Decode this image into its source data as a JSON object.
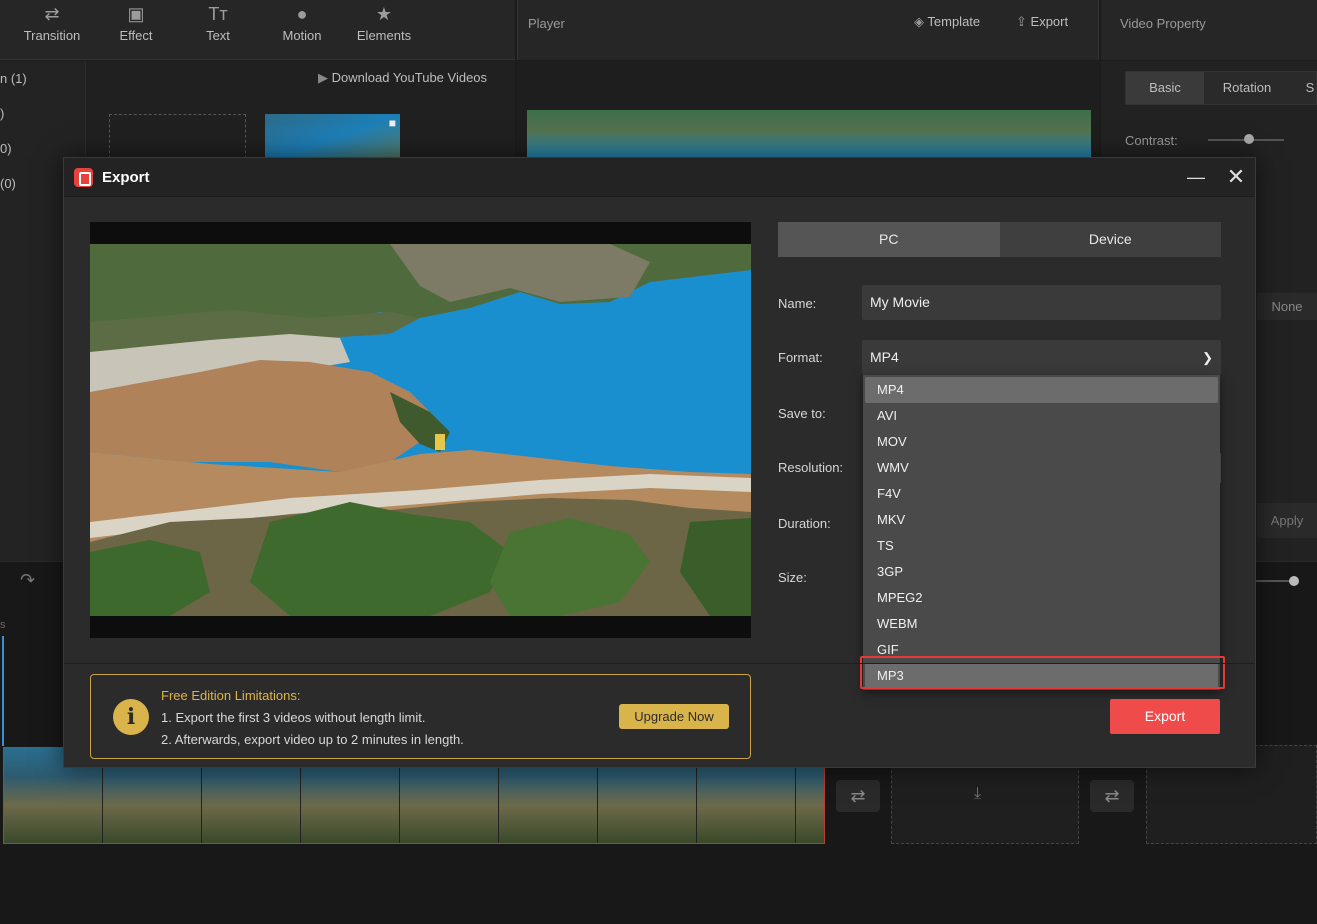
{
  "toolbar": {
    "items": [
      {
        "label": "Transition",
        "icon": "transition-icon"
      },
      {
        "label": "Effect",
        "icon": "effect-icon"
      },
      {
        "label": "Text",
        "icon": "text-icon"
      },
      {
        "label": "Motion",
        "icon": "motion-icon"
      },
      {
        "label": "Elements",
        "icon": "elements-icon"
      }
    ]
  },
  "media": {
    "sidebar": [
      "n (1)",
      ")",
      "0)",
      "(0)"
    ],
    "download_label": "Download YouTube Videos"
  },
  "player": {
    "title": "Player",
    "template_label": "Template",
    "export_label": "Export"
  },
  "property": {
    "title": "Video Property",
    "tabs": [
      "Basic",
      "Rotation",
      "S"
    ],
    "contrast_label": "Contrast:",
    "none_label": "None",
    "apply_label": "Apply"
  },
  "timeline": {
    "ruler_fragment": "s"
  },
  "dialog": {
    "title": "Export",
    "tabs": {
      "pc": "PC",
      "device": "Device"
    },
    "labels": {
      "name": "Name:",
      "format": "Format:",
      "save_to": "Save to:",
      "resolution": "Resolution:",
      "duration": "Duration:",
      "size": "Size:"
    },
    "name_value": "My Movie",
    "format_value": "MP4",
    "format_options": [
      "MP4",
      "AVI",
      "MOV",
      "WMV",
      "F4V",
      "MKV",
      "TS",
      "3GP",
      "MPEG2",
      "WEBM",
      "GIF",
      "MP3"
    ],
    "selected_option": "MP4",
    "highlighted_option": "MP3",
    "notice": {
      "title": "Free Edition Limitations:",
      "line1": "1. Export the first 3 videos without length limit.",
      "line2": "2. Afterwards, export video up to 2 minutes in length.",
      "upgrade_label": "Upgrade Now"
    },
    "export_label": "Export"
  },
  "colors": {
    "accent_red": "#f04b4b",
    "highlight_red": "#e53935",
    "notice_gold": "#d9b44a"
  }
}
